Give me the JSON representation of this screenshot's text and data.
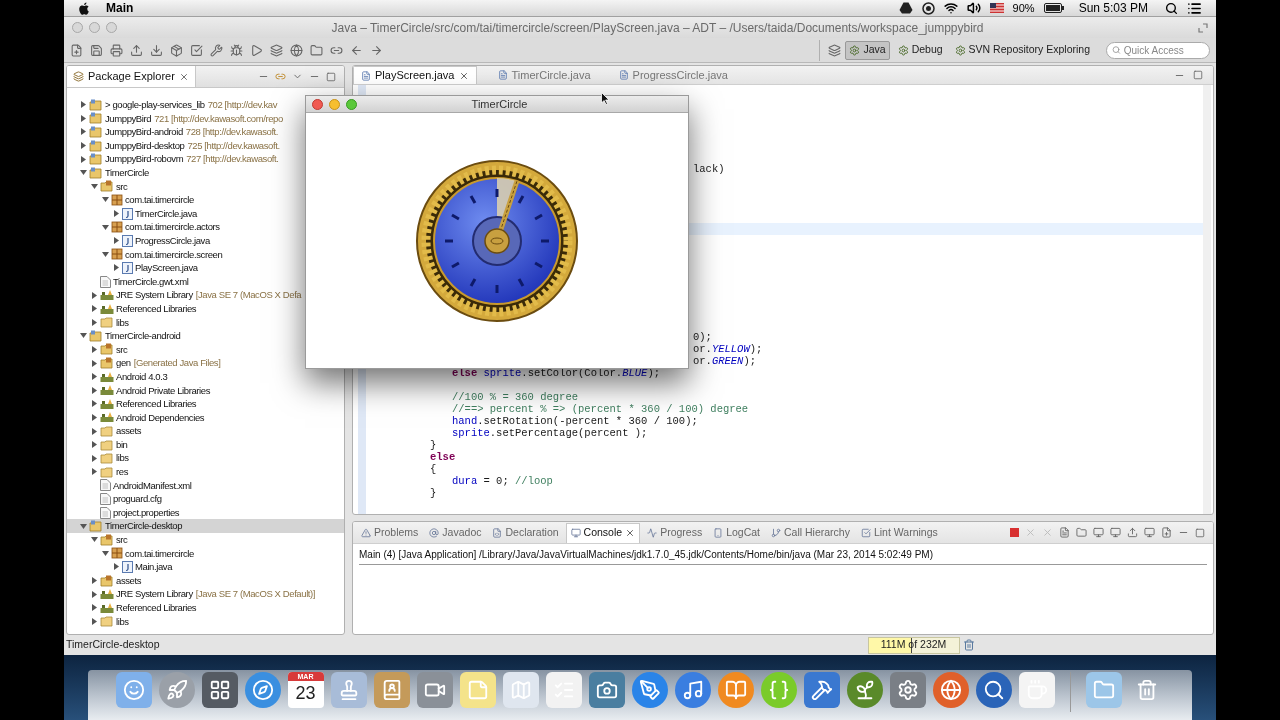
{
  "menu_bar": {
    "app_name": "Main",
    "battery": "90%",
    "clock": "Sun 5:03 PM"
  },
  "window": {
    "title": "Java – TimerCircle/src/com/tai/timercircle/screen/PlayScreen.java – ADT – /Users/taida/Documents/workspace_jumppybird"
  },
  "toolbar": {
    "perspectives": [
      {
        "label": "Java",
        "selected": true
      },
      {
        "label": "Debug",
        "selected": false
      },
      {
        "label": "SVN Repository Exploring",
        "selected": false
      }
    ],
    "quick_access": {
      "placeholder": "Quick Access"
    }
  },
  "package_explorer": {
    "title": "Package Explorer",
    "tree": [
      {
        "name": "> google-play-services_lib",
        "decoration": "702 [http://dev.kav",
        "kind": "project",
        "expanded": false,
        "selected": false
      },
      {
        "name": "JumppyBird",
        "decoration": "721 [http://dev.kawasoft.com/repo",
        "kind": "project",
        "expanded": false,
        "selected": false
      },
      {
        "name": "JumppyBird-android",
        "decoration": "728 [http://dev.kawasoft.",
        "kind": "project",
        "expanded": false,
        "selected": false
      },
      {
        "name": "JumppyBird-desktop",
        "decoration": "725 [http://dev.kawasoft.",
        "kind": "project",
        "expanded": false,
        "selected": false
      },
      {
        "name": "JumppyBird-robovm",
        "decoration": "727 [http://dev.kawasoft.",
        "kind": "project",
        "expanded": false,
        "selected": false
      },
      {
        "name": "TimerCircle",
        "kind": "project",
        "expanded": true,
        "selected": false,
        "children": [
          {
            "name": "src",
            "kind": "source",
            "expanded": true,
            "selected": false,
            "children": [
              {
                "name": "com.tai.timercircle",
                "kind": "package",
                "expanded": true,
                "selected": false,
                "children": [
                  {
                    "name": "TimerCircle.java",
                    "kind": "java",
                    "expanded": false,
                    "selected": false
                  }
                ]
              },
              {
                "name": "com.tai.timercircle.actors",
                "kind": "package",
                "expanded": true,
                "selected": false,
                "children": [
                  {
                    "name": "ProgressCircle.java",
                    "kind": "java",
                    "expanded": false,
                    "selected": false
                  }
                ]
              },
              {
                "name": "com.tai.timercircle.screen",
                "kind": "package",
                "expanded": true,
                "selected": false,
                "children": [
                  {
                    "name": "PlayScreen.java",
                    "kind": "java",
                    "expanded": false,
                    "selected": false
                  }
                ]
              }
            ]
          },
          {
            "name": "TimerCircle.gwt.xml",
            "kind": "file",
            "selected": false
          },
          {
            "name": "JRE System Library",
            "decoration": "[Java SE 7 (MacOS X Defa",
            "kind": "library",
            "expanded": false,
            "selected": false
          },
          {
            "name": "Referenced Libraries",
            "kind": "library",
            "expanded": false,
            "selected": false
          },
          {
            "name": "libs",
            "kind": "folder",
            "expanded": false,
            "selected": false
          }
        ]
      },
      {
        "name": "TimerCircle-android",
        "kind": "project",
        "expanded": true,
        "selected": false,
        "children": [
          {
            "name": "src",
            "kind": "source",
            "expanded": false,
            "selected": false
          },
          {
            "name": "gen",
            "decoration": "[Generated Java Files]",
            "kind": "source",
            "expanded": false,
            "selected": false
          },
          {
            "name": "Android 4.0.3",
            "kind": "library",
            "expanded": false,
            "selected": false
          },
          {
            "name": "Android Private Libraries",
            "kind": "library",
            "expanded": false,
            "selected": false
          },
          {
            "name": "Referenced Libraries",
            "kind": "library",
            "expanded": false,
            "selected": false
          },
          {
            "name": "Android Dependencies",
            "kind": "library",
            "expanded": false,
            "selected": false
          },
          {
            "name": "assets",
            "kind": "folder",
            "expanded": false,
            "selected": false
          },
          {
            "name": "bin",
            "kind": "folder",
            "expanded": false,
            "selected": false
          },
          {
            "name": "libs",
            "kind": "folder",
            "expanded": false,
            "selected": false
          },
          {
            "name": "res",
            "kind": "folder",
            "expanded": false,
            "selected": false
          },
          {
            "name": "AndroidManifest.xml",
            "kind": "file",
            "selected": false
          },
          {
            "name": "proguard.cfg",
            "kind": "file",
            "selected": false
          },
          {
            "name": "project.properties",
            "kind": "file",
            "selected": false
          }
        ]
      },
      {
        "name": "TimerCircle-desktop",
        "kind": "project",
        "expanded": true,
        "selected": true,
        "children": [
          {
            "name": "src",
            "kind": "source",
            "expanded": true,
            "selected": false,
            "children": [
              {
                "name": "com.tai.timercircle",
                "kind": "package",
                "expanded": true,
                "selected": false,
                "children": [
                  {
                    "name": "Main.java",
                    "kind": "java",
                    "expanded": false,
                    "selected": false
                  }
                ]
              }
            ]
          },
          {
            "name": "assets",
            "kind": "source",
            "expanded": false,
            "selected": false
          },
          {
            "name": "JRE System Library",
            "decoration": "[Java SE 7 (MacOS X Default)]",
            "kind": "library",
            "expanded": false,
            "selected": false
          },
          {
            "name": "Referenced Libraries",
            "kind": "library",
            "expanded": false,
            "selected": false
          },
          {
            "name": "libs",
            "kind": "folder",
            "expanded": false,
            "selected": false
          }
        ]
      }
    ]
  },
  "editor": {
    "tabs": [
      {
        "label": "PlayScreen.java",
        "selected": true
      },
      {
        "label": "TimerCircle.java",
        "selected": false
      },
      {
        "label": "ProgressCircle.java",
        "selected": false
      }
    ],
    "lines": [
      {
        "kind": "clipped",
        "segments": [
          {
            "text": "lack)",
            "kind": "plain"
          }
        ]
      },
      {
        "kind": "blank"
      },
      {
        "kind": "blank"
      },
      {
        "kind": "blank"
      },
      {
        "kind": "blank"
      },
      {
        "kind": "current"
      },
      {
        "kind": "blank"
      },
      {
        "kind": "blank"
      },
      {
        "kind": "blank"
      },
      {
        "kind": "blank"
      },
      {
        "kind": "blank"
      },
      {
        "kind": "blank"
      },
      {
        "kind": "blank"
      },
      {
        "kind": "blank"
      },
      {
        "kind": "clipped",
        "segments": [
          {
            "text": "0);",
            "kind": "plain"
          }
        ]
      },
      {
        "kind": "clipped",
        "segments": [
          {
            "text": "or.",
            "kind": "plain"
          },
          {
            "text": "YELLOW",
            "kind": "constant"
          },
          {
            "text": ");",
            "kind": "plain"
          }
        ]
      },
      {
        "kind": "clipped",
        "segments": [
          {
            "text": "or.",
            "kind": "plain"
          },
          {
            "text": "GREEN",
            "kind": "constant"
          },
          {
            "text": ");",
            "kind": "plain"
          }
        ]
      },
      {
        "kind": "code",
        "segments": [
          {
            "text": "\t\t\telse",
            "kind": "keyword"
          },
          {
            "text": " sprite",
            "kind": "field"
          },
          {
            "text": ".setColor(Color.",
            "kind": "plain"
          },
          {
            "text": "BLUE",
            "kind": "constant"
          },
          {
            "text": ");",
            "kind": "plain"
          }
        ]
      },
      {
        "kind": "blank"
      },
      {
        "kind": "code",
        "segments": [
          {
            "text": "\t\t\t//100 % = 360 degree",
            "kind": "comment"
          }
        ]
      },
      {
        "kind": "code",
        "segments": [
          {
            "text": "\t\t\t//==> percent % => (percent * 360 / 100) degree",
            "kind": "comment"
          }
        ]
      },
      {
        "kind": "code",
        "segments": [
          {
            "text": "\t\t\thand",
            "kind": "field"
          },
          {
            "text": ".setRotation(-percent * 360 / 100);",
            "kind": "plain"
          }
        ]
      },
      {
        "kind": "code",
        "segments": [
          {
            "text": "\t\t\tsprite",
            "kind": "field"
          },
          {
            "text": ".setPercentage(percent );",
            "kind": "plain"
          }
        ]
      },
      {
        "kind": "code",
        "segments": [
          {
            "text": "\t\t}",
            "kind": "plain"
          }
        ]
      },
      {
        "kind": "code",
        "segments": [
          {
            "text": "\t\telse",
            "kind": "keyword"
          }
        ]
      },
      {
        "kind": "code",
        "segments": [
          {
            "text": "\t\t{",
            "kind": "plain"
          }
        ]
      },
      {
        "kind": "code",
        "segments": [
          {
            "text": "\t\t\tdura",
            "kind": "field"
          },
          {
            "text": " = 0; ",
            "kind": "plain"
          },
          {
            "text": "//loop",
            "kind": "comment"
          }
        ]
      },
      {
        "kind": "code",
        "segments": [
          {
            "text": "\t\t}",
            "kind": "plain"
          }
        ]
      }
    ]
  },
  "bottom_panel": {
    "tabs": [
      {
        "label": "Problems",
        "selected": false
      },
      {
        "label": "Javadoc",
        "selected": false
      },
      {
        "label": "Declaration",
        "selected": false
      },
      {
        "label": "Console",
        "selected": true
      },
      {
        "label": "Progress",
        "selected": false
      },
      {
        "label": "LogCat",
        "selected": false
      },
      {
        "label": "Call Hierarchy",
        "selected": false
      },
      {
        "label": "Lint Warnings",
        "selected": false
      }
    ],
    "console_header": "Main (4) [Java Application] /Library/Java/JavaVirtualMachines/jdk1.7.0_45.jdk/Contents/Home/bin/java (Mar 23, 2014 5:02:49 PM)"
  },
  "status_bar": {
    "selection": "TimerCircle-desktop",
    "memory": {
      "reading": "111M of 232M",
      "level": 0.48
    }
  },
  "floating_window": {
    "title": "TimerCircle"
  },
  "dock": {
    "calendar_month": "MAR",
    "calendar_day": "23"
  }
}
